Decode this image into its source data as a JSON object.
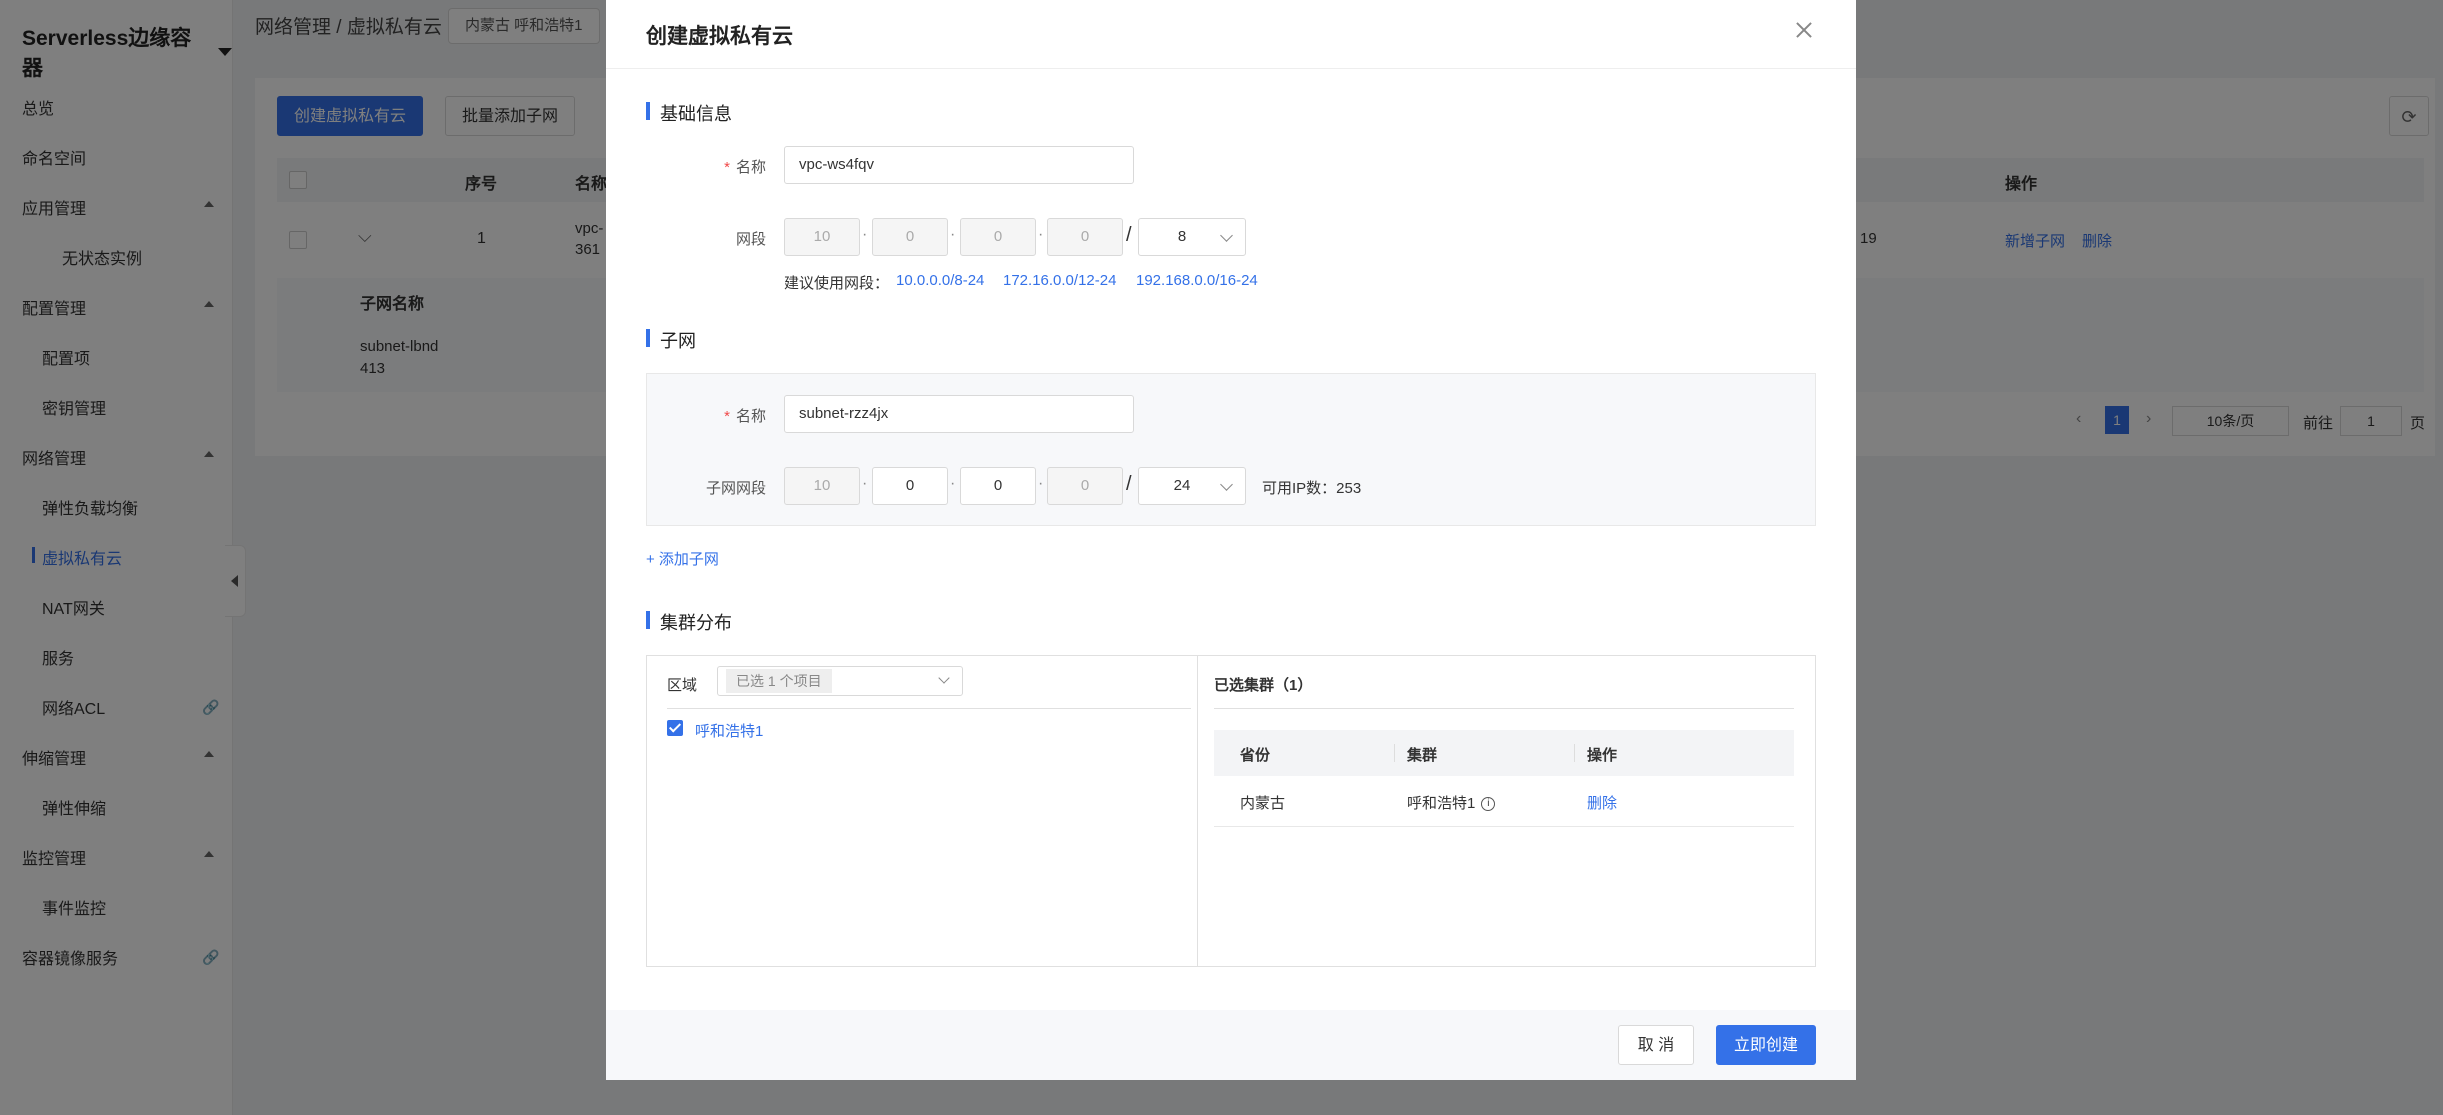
{
  "sidebar": {
    "title": "Serverless边缘容器",
    "items": [
      {
        "label": "总览"
      },
      {
        "label": "命名空间"
      },
      {
        "label": "应用管理"
      },
      {
        "label": "无状态实例"
      },
      {
        "label": "配置管理"
      },
      {
        "label": "配置项"
      },
      {
        "label": "密钥管理"
      },
      {
        "label": "网络管理"
      },
      {
        "label": "弹性负载均衡"
      },
      {
        "label": "虚拟私有云"
      },
      {
        "label": "NAT网关"
      },
      {
        "label": "服务"
      },
      {
        "label": "网络ACL"
      },
      {
        "label": "伸缩管理"
      },
      {
        "label": "弹性伸缩"
      },
      {
        "label": "监控管理"
      },
      {
        "label": "事件监控"
      },
      {
        "label": "容器镜像服务"
      }
    ]
  },
  "header": {
    "breadcrumb": "网络管理 / 虚拟私有云",
    "region_chip": "内蒙古 呼和浩特1"
  },
  "background": {
    "btn_create": "创建虚拟私有云",
    "btn_batch": "批量添加子网",
    "col_seq": "序号",
    "col_name": "名称",
    "col_ops": "操作",
    "row_seq": "1",
    "row_name_1": "vpc-",
    "row_name_2": "361",
    "row_partial": "19",
    "op_add_subnet": "新增子网",
    "op_delete": "删除",
    "sub_col_name": "子网名称",
    "sub_row_1": "subnet-lbnd",
    "sub_row_2": "413",
    "page_current": "1",
    "page_size": "10条/页",
    "goto_label": "前往",
    "goto_value": "1",
    "page_unit": "页"
  },
  "modal": {
    "title": "创建虚拟私有云",
    "basic_title": "基础信息",
    "name_label": "名称",
    "name_value": "vpc-ws4fqv",
    "cidr_label": "网段",
    "cidr": [
      "10",
      "0",
      "0",
      "0"
    ],
    "cidr_mask": "8",
    "suggest_label": "建议使用网段：",
    "suggest": [
      "10.0.0.0/8-24",
      "172.16.0.0/12-24",
      "192.168.0.0/16-24"
    ],
    "subnet_title": "子网",
    "subnet_name_label": "名称",
    "subnet_name_value": "subnet-rzz4jx",
    "subnet_cidr_label": "子网网段",
    "subnet_cidr": [
      "10",
      "0",
      "0",
      "0"
    ],
    "subnet_mask": "24",
    "available_ip": "可用IP数：253",
    "add_subnet": "+ 添加子网",
    "cluster_title": "集群分布",
    "region_label": "区域",
    "region_select": "已选 1 个项目",
    "region_option": "呼和浩特1",
    "selected_title": "已选集群（1）",
    "col_province": "省份",
    "col_cluster": "集群",
    "col_op": "操作",
    "row_province": "内蒙古",
    "row_cluster": "呼和浩特1",
    "row_op": "删除",
    "cancel": "取 消",
    "submit": "立即创建"
  }
}
